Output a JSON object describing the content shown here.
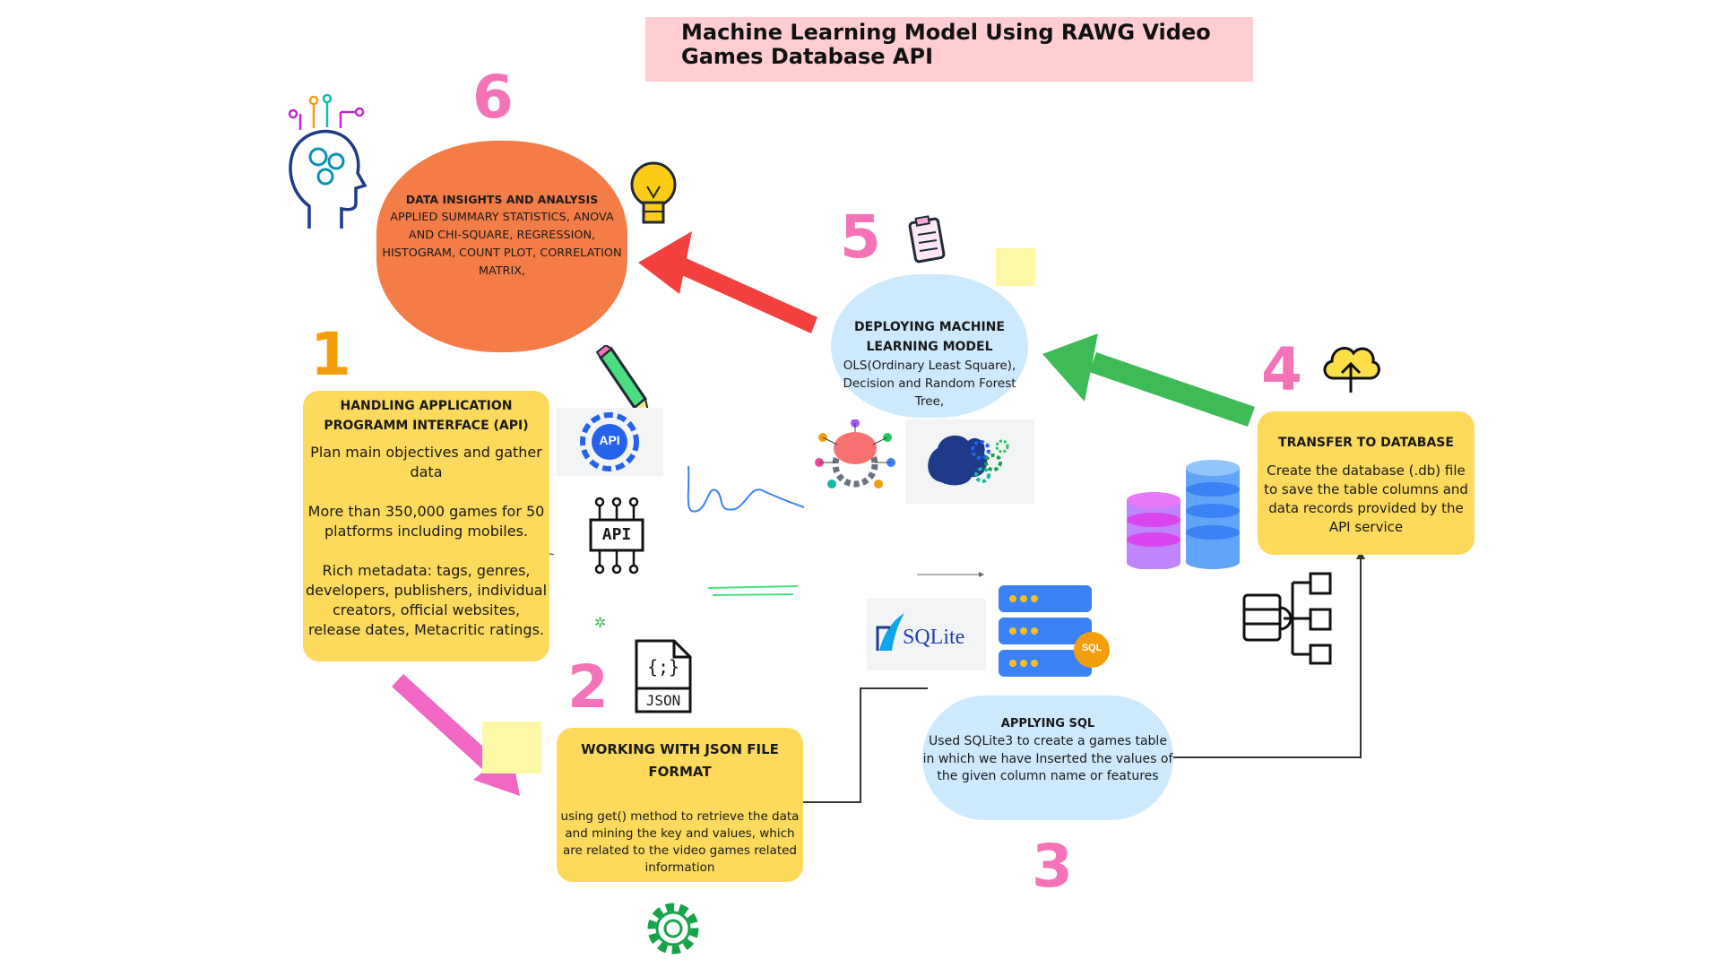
{
  "title": "Machine Learning Model Using RAWG Video Games Database API",
  "steps": {
    "s1": {
      "number": "1",
      "heading": "HANDLING APPLICATION PROGRAMM INTERFACE (API)",
      "line1": "Plan main objectives and gather data",
      "line2": "More than 350,000 games for 50 platforms including mobiles.",
      "line3": "Rich metadata: tags, genres, developers, publishers, individual creators, official websites, release dates, Metacritic ratings."
    },
    "s2": {
      "number": "2",
      "heading": "WORKING WITH JSON FILE FORMAT",
      "body": "using get() method to retrieve the data and mining the key and values, which are related to the video games related information"
    },
    "s3": {
      "number": "3",
      "heading": "APPLYING SQL",
      "body": "Used SQLite3 to create a games table in which we have Inserted the values of the given column name or features"
    },
    "s4": {
      "number": "4",
      "heading": "TRANSFER TO DATABASE",
      "body": "Create the database (.db) file to save the table columns and data records provided by the API service"
    },
    "s5": {
      "number": "5",
      "heading": "DEPLOYING MACHINE LEARNING MODEL",
      "body": "OLS(Ordinary Least Square), Decision and Random Forest Tree,"
    },
    "s6": {
      "number": "6",
      "heading": "DATA INSIGHTS AND ANALYSIS",
      "body": "APPLIED SUMMARY STATISTICS, ANOVA AND CHI-SQUARE, REGRESSION, HISTOGRAM, COUNT PLOT, CORRELATION MATRIX,"
    }
  },
  "icon_labels": {
    "api_gear": "API",
    "api_chip": "API",
    "json": "JSON",
    "json_braces": "{;}",
    "sql": "SQL",
    "sqlite": "SQLite"
  },
  "colors": {
    "title_bg": "#ffcdd2",
    "yellow_box": "#fdd95c",
    "orange_box": "#f47c47",
    "blue_box": "#cde9fd",
    "number_pink": "#f472b6",
    "number_orange": "#f59e0b",
    "arrow_red": "#f43f3f",
    "arrow_green": "#3dbb57",
    "arrow_pink": "#f067c4"
  },
  "icons": [
    "ai-head-icon",
    "lightbulb-icon",
    "clipboard-icon",
    "pencil-icon",
    "api-gear-icon",
    "api-chip-icon",
    "json-file-icon",
    "gear-icon",
    "brain-gears-icon",
    "brain-network-icon",
    "database-stack-icon",
    "cloud-upload-icon",
    "data-hierarchy-icon",
    "sqlite-logo-icon",
    "sql-server-icon"
  ]
}
